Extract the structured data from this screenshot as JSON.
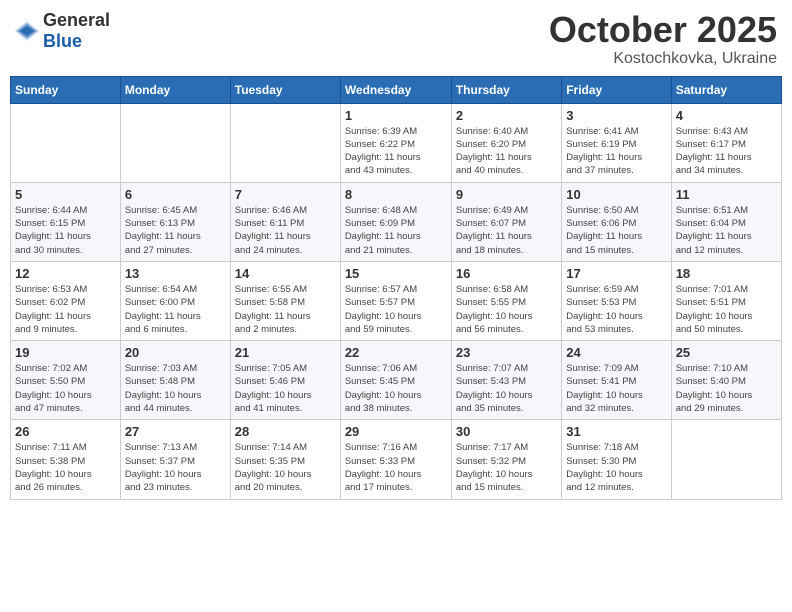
{
  "header": {
    "logo_general": "General",
    "logo_blue": "Blue",
    "month": "October 2025",
    "location": "Kostochkovka, Ukraine"
  },
  "weekdays": [
    "Sunday",
    "Monday",
    "Tuesday",
    "Wednesday",
    "Thursday",
    "Friday",
    "Saturday"
  ],
  "weeks": [
    [
      {
        "day": "",
        "info": ""
      },
      {
        "day": "",
        "info": ""
      },
      {
        "day": "",
        "info": ""
      },
      {
        "day": "1",
        "info": "Sunrise: 6:39 AM\nSunset: 6:22 PM\nDaylight: 11 hours\nand 43 minutes."
      },
      {
        "day": "2",
        "info": "Sunrise: 6:40 AM\nSunset: 6:20 PM\nDaylight: 11 hours\nand 40 minutes."
      },
      {
        "day": "3",
        "info": "Sunrise: 6:41 AM\nSunset: 6:19 PM\nDaylight: 11 hours\nand 37 minutes."
      },
      {
        "day": "4",
        "info": "Sunrise: 6:43 AM\nSunset: 6:17 PM\nDaylight: 11 hours\nand 34 minutes."
      }
    ],
    [
      {
        "day": "5",
        "info": "Sunrise: 6:44 AM\nSunset: 6:15 PM\nDaylight: 11 hours\nand 30 minutes."
      },
      {
        "day": "6",
        "info": "Sunrise: 6:45 AM\nSunset: 6:13 PM\nDaylight: 11 hours\nand 27 minutes."
      },
      {
        "day": "7",
        "info": "Sunrise: 6:46 AM\nSunset: 6:11 PM\nDaylight: 11 hours\nand 24 minutes."
      },
      {
        "day": "8",
        "info": "Sunrise: 6:48 AM\nSunset: 6:09 PM\nDaylight: 11 hours\nand 21 minutes."
      },
      {
        "day": "9",
        "info": "Sunrise: 6:49 AM\nSunset: 6:07 PM\nDaylight: 11 hours\nand 18 minutes."
      },
      {
        "day": "10",
        "info": "Sunrise: 6:50 AM\nSunset: 6:06 PM\nDaylight: 11 hours\nand 15 minutes."
      },
      {
        "day": "11",
        "info": "Sunrise: 6:51 AM\nSunset: 6:04 PM\nDaylight: 11 hours\nand 12 minutes."
      }
    ],
    [
      {
        "day": "12",
        "info": "Sunrise: 6:53 AM\nSunset: 6:02 PM\nDaylight: 11 hours\nand 9 minutes."
      },
      {
        "day": "13",
        "info": "Sunrise: 6:54 AM\nSunset: 6:00 PM\nDaylight: 11 hours\nand 6 minutes."
      },
      {
        "day": "14",
        "info": "Sunrise: 6:55 AM\nSunset: 5:58 PM\nDaylight: 11 hours\nand 2 minutes."
      },
      {
        "day": "15",
        "info": "Sunrise: 6:57 AM\nSunset: 5:57 PM\nDaylight: 10 hours\nand 59 minutes."
      },
      {
        "day": "16",
        "info": "Sunrise: 6:58 AM\nSunset: 5:55 PM\nDaylight: 10 hours\nand 56 minutes."
      },
      {
        "day": "17",
        "info": "Sunrise: 6:59 AM\nSunset: 5:53 PM\nDaylight: 10 hours\nand 53 minutes."
      },
      {
        "day": "18",
        "info": "Sunrise: 7:01 AM\nSunset: 5:51 PM\nDaylight: 10 hours\nand 50 minutes."
      }
    ],
    [
      {
        "day": "19",
        "info": "Sunrise: 7:02 AM\nSunset: 5:50 PM\nDaylight: 10 hours\nand 47 minutes."
      },
      {
        "day": "20",
        "info": "Sunrise: 7:03 AM\nSunset: 5:48 PM\nDaylight: 10 hours\nand 44 minutes."
      },
      {
        "day": "21",
        "info": "Sunrise: 7:05 AM\nSunset: 5:46 PM\nDaylight: 10 hours\nand 41 minutes."
      },
      {
        "day": "22",
        "info": "Sunrise: 7:06 AM\nSunset: 5:45 PM\nDaylight: 10 hours\nand 38 minutes."
      },
      {
        "day": "23",
        "info": "Sunrise: 7:07 AM\nSunset: 5:43 PM\nDaylight: 10 hours\nand 35 minutes."
      },
      {
        "day": "24",
        "info": "Sunrise: 7:09 AM\nSunset: 5:41 PM\nDaylight: 10 hours\nand 32 minutes."
      },
      {
        "day": "25",
        "info": "Sunrise: 7:10 AM\nSunset: 5:40 PM\nDaylight: 10 hours\nand 29 minutes."
      }
    ],
    [
      {
        "day": "26",
        "info": "Sunrise: 7:11 AM\nSunset: 5:38 PM\nDaylight: 10 hours\nand 26 minutes."
      },
      {
        "day": "27",
        "info": "Sunrise: 7:13 AM\nSunset: 5:37 PM\nDaylight: 10 hours\nand 23 minutes."
      },
      {
        "day": "28",
        "info": "Sunrise: 7:14 AM\nSunset: 5:35 PM\nDaylight: 10 hours\nand 20 minutes."
      },
      {
        "day": "29",
        "info": "Sunrise: 7:16 AM\nSunset: 5:33 PM\nDaylight: 10 hours\nand 17 minutes."
      },
      {
        "day": "30",
        "info": "Sunrise: 7:17 AM\nSunset: 5:32 PM\nDaylight: 10 hours\nand 15 minutes."
      },
      {
        "day": "31",
        "info": "Sunrise: 7:18 AM\nSunset: 5:30 PM\nDaylight: 10 hours\nand 12 minutes."
      },
      {
        "day": "",
        "info": ""
      }
    ]
  ]
}
